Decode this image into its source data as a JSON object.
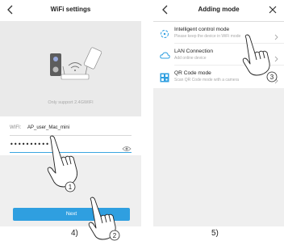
{
  "wifi_screen": {
    "title": "WiFi settings",
    "back_icon": "chevron-left-icon",
    "hero_caption": "Only support 2.4GWIFI",
    "wifi_label": "WIFI:",
    "wifi_value": "AP_user_Mac_mini",
    "password_value": "••••••••••",
    "eye_icon": "eye-icon",
    "next_label": "Next"
  },
  "mode_screen": {
    "title": "Adding mode",
    "back_icon": "chevron-left-icon",
    "close_icon": "close-icon",
    "items": [
      {
        "title": "Intelligent control mode",
        "subtitle": "Please keep the device in WiFi mode",
        "icon": "smart-config-icon"
      },
      {
        "title": "LAN Connection",
        "subtitle": "Add online device",
        "icon": "cloud-icon"
      },
      {
        "title": "QR Code mode",
        "subtitle": "Scan QR Code mode with a camera",
        "icon": "qr-code-icon"
      }
    ]
  },
  "annotations": {
    "step_left": "4)",
    "step_right": "5)",
    "marker_1": "1",
    "marker_2": "2",
    "marker_3": "3"
  },
  "colors": {
    "accent": "#2f9fe0",
    "background": "#efefef",
    "card": "#ffffff"
  }
}
